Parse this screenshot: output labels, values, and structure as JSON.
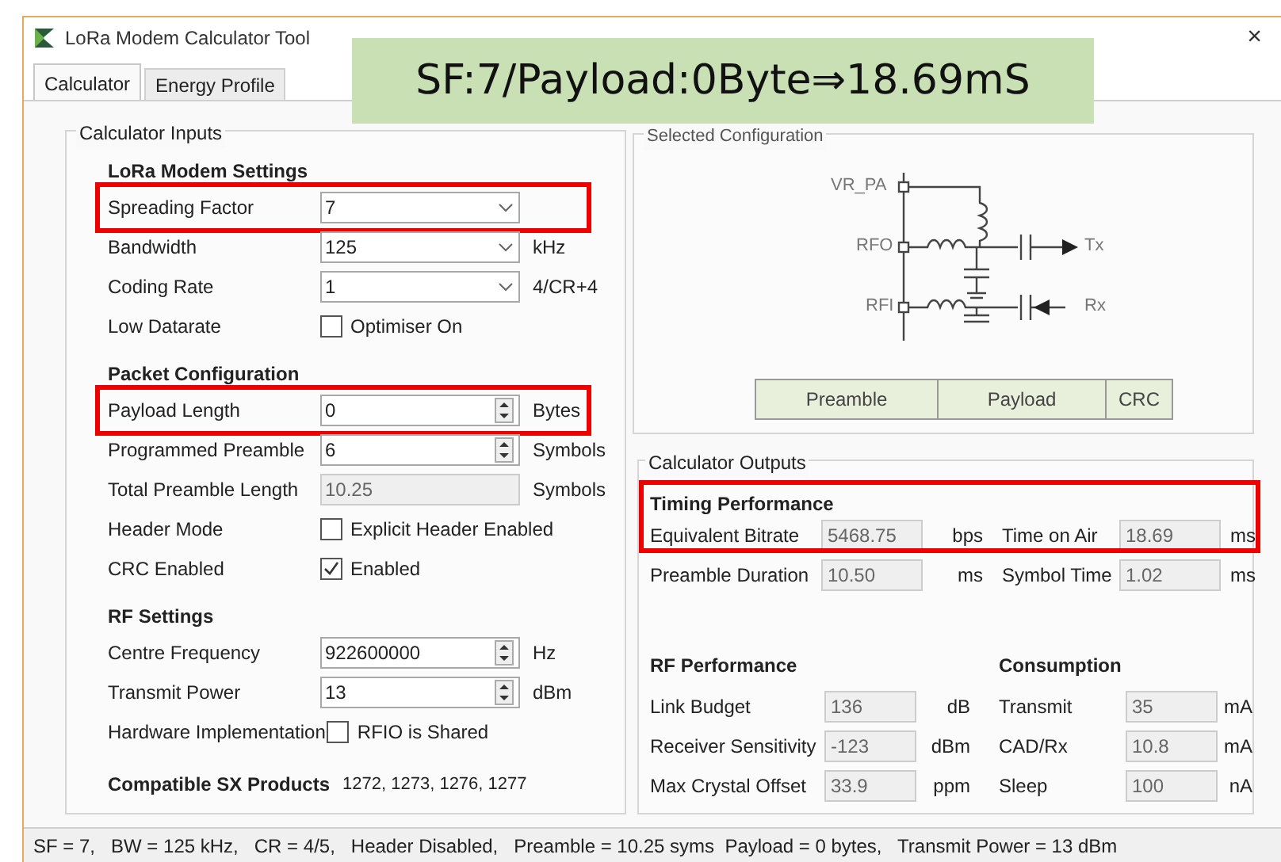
{
  "window": {
    "title": "LoRa Modem Calculator Tool",
    "close": "×"
  },
  "banner": "SF:7/Payload:0Byte⇒18.69mS",
  "tabs": [
    {
      "label": "Calculator",
      "selected": true
    },
    {
      "label": "Energy Profile",
      "selected": false
    }
  ],
  "inputs": {
    "title": "Calculator Inputs",
    "sections": [
      {
        "heading": "LoRa Modem Settings",
        "rows": [
          {
            "kind": "select",
            "label": "Spreading Factor",
            "value": "7",
            "highlighted": true
          },
          {
            "kind": "select",
            "label": "Bandwidth",
            "value": "125",
            "unit": "kHz",
            "highlighted": false
          },
          {
            "kind": "select",
            "label": "Coding Rate",
            "value": "1",
            "unit": "4/CR+4",
            "highlighted": false
          },
          {
            "kind": "checkbox",
            "label": "Low Datarate",
            "text": "Optimiser On",
            "checked": false,
            "highlighted": false
          }
        ]
      },
      {
        "heading": "Packet Configuration",
        "rows": [
          {
            "kind": "spin",
            "label": "Payload Length",
            "value": "0",
            "unit": "Bytes",
            "highlighted": true
          },
          {
            "kind": "spin",
            "label": "Programmed Preamble",
            "value": "6",
            "unit": "Symbols",
            "highlighted": false
          },
          {
            "kind": "readonly",
            "label": "Total Preamble Length",
            "value": "10.25",
            "unit": "Symbols",
            "highlighted": false
          },
          {
            "kind": "checkbox",
            "label": "Header Mode",
            "text": "Explicit Header Enabled",
            "checked": false,
            "highlighted": false
          },
          {
            "kind": "checkbox",
            "label": "CRC Enabled",
            "text": "Enabled",
            "checked": true,
            "highlighted": false
          }
        ]
      },
      {
        "heading": "RF Settings",
        "rows": [
          {
            "kind": "spin",
            "label": "Centre Frequency",
            "value": "922600000",
            "unit": "Hz",
            "highlighted": false
          },
          {
            "kind": "spin",
            "label": "Transmit Power",
            "value": "13",
            "unit": "dBm",
            "highlighted": false
          },
          {
            "kind": "checkbox",
            "label": "Hardware Implementation",
            "text": "RFIO is Shared",
            "checked": false,
            "highlighted": false
          }
        ]
      }
    ],
    "products": {
      "heading": "Compatible SX Products",
      "value": "1272, 1273, 1276, 1277"
    }
  },
  "configuration": {
    "title": "Selected Configuration",
    "pins": [
      "VR_PA",
      "RFO",
      "RFI"
    ],
    "tx": "Tx",
    "rx": "Rx",
    "packet": [
      "Preamble",
      "Payload",
      "CRC"
    ]
  },
  "outputs": {
    "title": "Calculator Outputs",
    "timing": {
      "heading": "Timing Performance",
      "highlighted": true,
      "fields": [
        {
          "label": "Equivalent Bitrate",
          "value": "5468.75",
          "unit": "bps"
        },
        {
          "label": "Time on Air",
          "value": "18.69",
          "unit": "ms"
        },
        {
          "label": "Preamble Duration",
          "value": "10.50",
          "unit": "ms"
        },
        {
          "label": "Symbol Time",
          "value": "1.02",
          "unit": "ms"
        }
      ]
    },
    "rf": {
      "heading": "RF Performance",
      "fields": [
        {
          "label": "Link Budget",
          "value": "136",
          "unit": "dB"
        },
        {
          "label": "Receiver Sensitivity",
          "value": "-123",
          "unit": "dBm"
        },
        {
          "label": "Max Crystal Offset",
          "value": "33.9",
          "unit": "ppm"
        }
      ]
    },
    "consumption": {
      "heading": "Consumption",
      "fields": [
        {
          "label": "Transmit",
          "value": "35",
          "unit": "mA"
        },
        {
          "label": "CAD/Rx",
          "value": "10.8",
          "unit": "mA"
        },
        {
          "label": "Sleep",
          "value": "100",
          "unit": "nA"
        }
      ]
    }
  },
  "status_bar": "SF = 7,   BW = 125 kHz,   CR = 4/5,   Header Disabled,   Preamble = 10.25 syms  Payload = 0 bytes,   Transmit Power = 13 dBm"
}
